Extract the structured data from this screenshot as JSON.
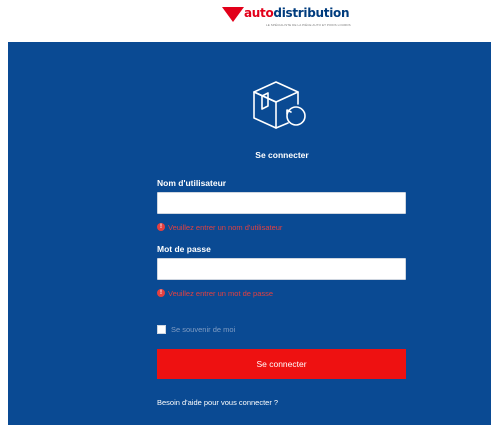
{
  "brand": {
    "logo_prefix": "auto",
    "logo_suffix": "distribution",
    "tagline": "LE SPÉCIALISTE DE LA PIÈCE AUTO ET POIDS LOURDS",
    "primary_color": "#0a4a93",
    "accent_color": "#e2001a"
  },
  "login": {
    "title": "Se connecter",
    "username_label": "Nom d'utilisateur",
    "username_value": "",
    "username_error": "Veuillez entrer un nom d'utilisateur",
    "password_label": "Mot de passe",
    "password_value": "",
    "password_error": "Veuillez entrer un mot de passe",
    "remember_label": "Se souvenir de moi",
    "remember_checked": false,
    "submit_label": "Se connecter",
    "help_link": "Besoin d'aide pour vous connecter ?"
  },
  "icons": {
    "logo_mark": "red-triangle-icon",
    "box": "box-return-icon",
    "error": "exclamation-circle-icon"
  }
}
